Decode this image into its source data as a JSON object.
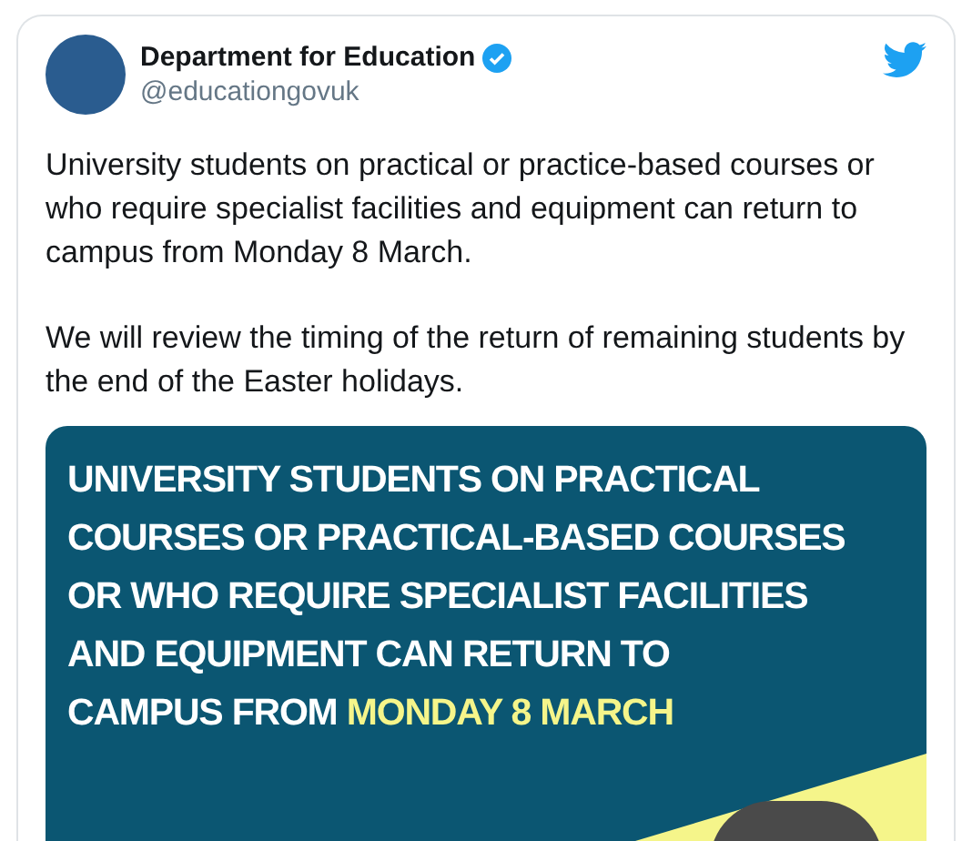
{
  "tweet": {
    "author": "Department for Education",
    "verified": true,
    "handle": "@educationgovuk",
    "paragraphs": [
      "University students on practical or practice-based courses or who require specialist facilities and equipment can return to campus from Monday 8 March.",
      "We will review the timing of the return of remaining students by the end of the Easter holidays."
    ],
    "graphic": {
      "headline": "UNIVERSITY STUDENTS ON PRACTICAL\nCOURSES OR PRACTICAL-BASED COURSES\nOR WHO REQUIRE SPECIALIST FACILITIES\nAND EQUIPMENT CAN RETURN TO\nCAMPUS FROM ",
      "highlight": "MONDAY 8 MARCH"
    }
  }
}
